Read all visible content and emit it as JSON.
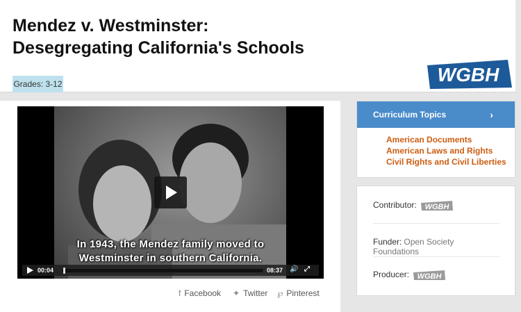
{
  "header": {
    "title_line1": "Mendez v. Westminster:",
    "title_line2": "Desegregating California's Schools",
    "grades": "Grades: 3-12",
    "logo_text": "WGBH"
  },
  "video": {
    "caption_line1": "In 1943, the Mendez family moved to",
    "caption_line2": "Westminster in southern California.",
    "current_time": "00:04",
    "total_time": "08:37",
    "progress_fraction": 0.008
  },
  "share": {
    "facebook": "Facebook",
    "twitter": "Twitter",
    "pinterest": "Pinterest"
  },
  "curriculum": {
    "heading": "Curriculum Topics",
    "topics": [
      "American Documents",
      "American Laws and Rights",
      "Civil Rights and Civil Liberties"
    ]
  },
  "credits": {
    "contributor_label": "Contributor:",
    "funder_label": "Funder:",
    "funder_value": "Open Society Foundations",
    "producer_label": "Producer:",
    "logo_text": "WGBH"
  },
  "colors": {
    "accent_blue": "#4a8bca",
    "topic_orange": "#cc5d10",
    "grade_badge": "#bfe1ee",
    "logo_blue": "#1d5a99"
  }
}
